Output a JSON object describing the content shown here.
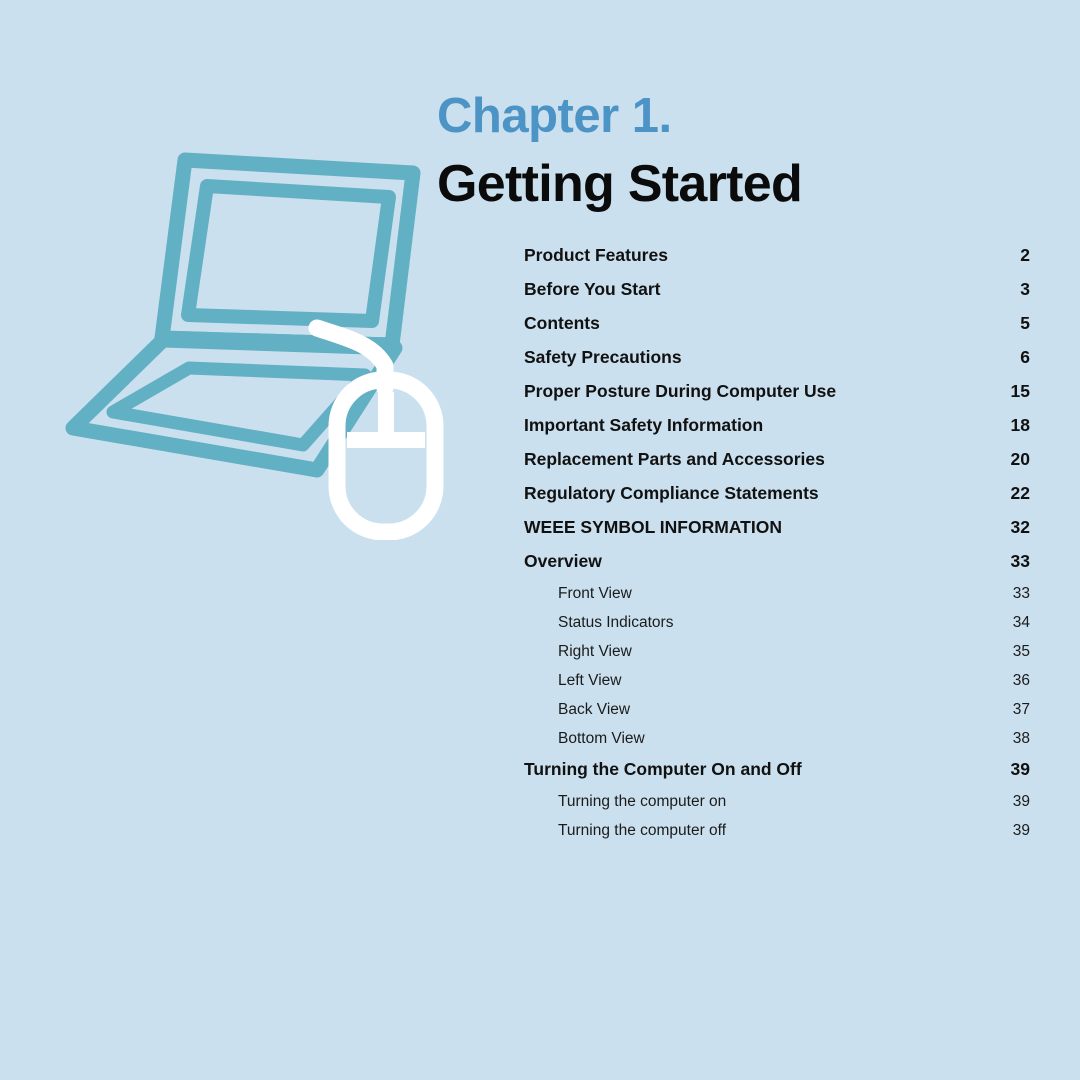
{
  "page": {
    "background_color": "#cbe0ee",
    "accent_color": "#62b0c4",
    "chapter_label_color": "#4c93c6",
    "heading_color": "#0b0b0b"
  },
  "header": {
    "chapter_label": "Chapter 1.",
    "chapter_title": "Getting Started"
  },
  "illustration": {
    "name": "laptop-and-mouse-illustration",
    "laptop_color": "#62b0c4",
    "mouse_color": "#ffffff"
  },
  "toc": {
    "entries": [
      {
        "label": "Product Features",
        "page": "2",
        "level": 1
      },
      {
        "label": "Before You Start",
        "page": "3",
        "level": 1
      },
      {
        "label": "Contents",
        "page": "5",
        "level": 1
      },
      {
        "label": "Safety Precautions",
        "page": "6",
        "level": 1
      },
      {
        "label": "Proper Posture During Computer Use",
        "page": "15",
        "level": 1
      },
      {
        "label": "Important Safety Information",
        "page": "18",
        "level": 1
      },
      {
        "label": "Replacement Parts and Accessories",
        "page": "20",
        "level": 1
      },
      {
        "label": "Regulatory Compliance Statements",
        "page": "22",
        "level": 1
      },
      {
        "label": "WEEE SYMBOL INFORMATION",
        "page": "32",
        "level": 1
      },
      {
        "label": "Overview",
        "page": "33",
        "level": 1
      },
      {
        "label": "Front View",
        "page": "33",
        "level": 2
      },
      {
        "label": "Status Indicators",
        "page": "34",
        "level": 2
      },
      {
        "label": "Right View",
        "page": "35",
        "level": 2
      },
      {
        "label": "Left View",
        "page": "36",
        "level": 2
      },
      {
        "label": "Back View",
        "page": "37",
        "level": 2
      },
      {
        "label": "Bottom View",
        "page": "38",
        "level": 2
      },
      {
        "label": "Turning the Computer On and Off",
        "page": "39",
        "level": 1
      },
      {
        "label": "Turning the computer on",
        "page": "39",
        "level": 2
      },
      {
        "label": "Turning the computer off",
        "page": "39",
        "level": 2
      }
    ]
  }
}
